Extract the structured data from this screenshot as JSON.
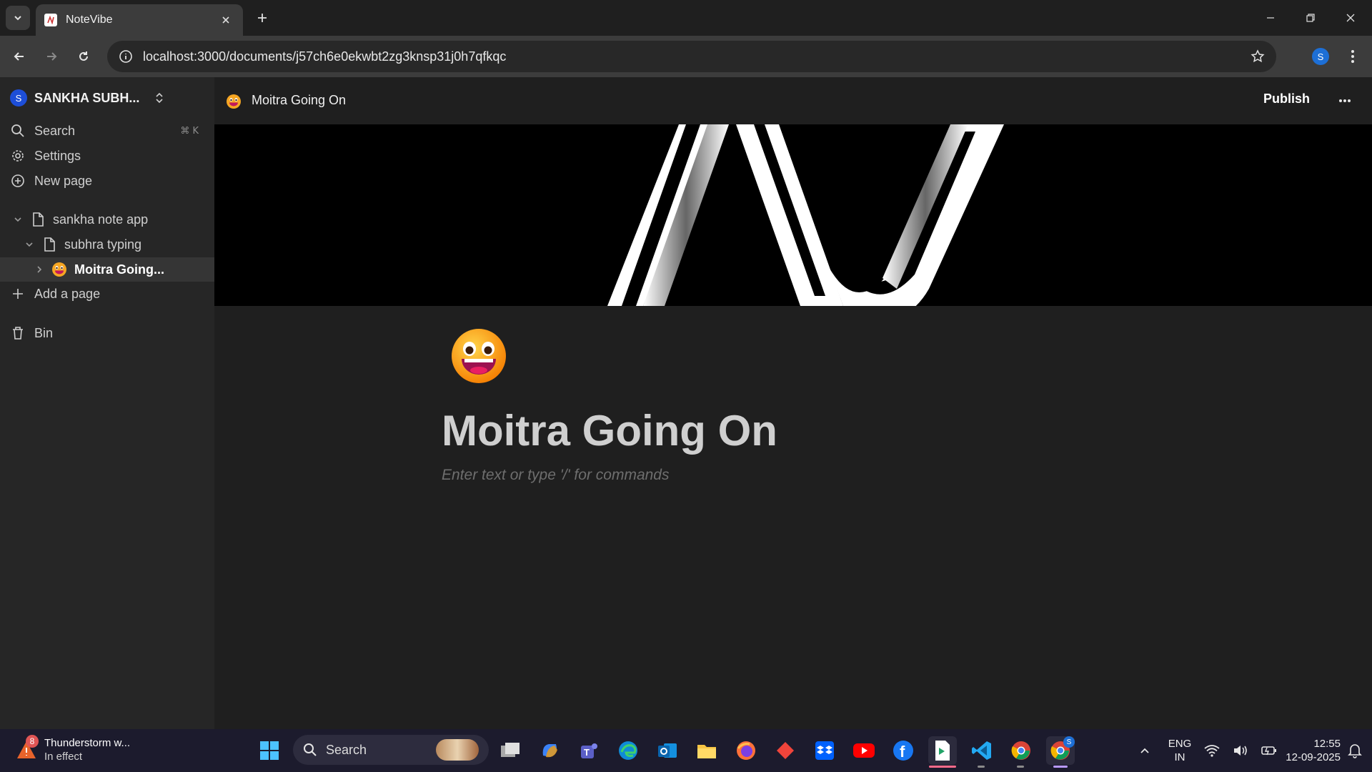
{
  "browser": {
    "tab_title": "NoteVibe",
    "url": "localhost:3000/documents/j57ch6e0ekwbt2zg3knsp31j0h7qfkqc",
    "profile_initial": "S"
  },
  "sidebar": {
    "workspace_initial": "S",
    "workspace_name": "SANKHA SUBH...",
    "search_label": "Search",
    "search_shortcut": "⌘ K",
    "settings_label": "Settings",
    "new_page_label": "New page",
    "pages": [
      {
        "label": "sankha note app"
      },
      {
        "label": "subhra typing"
      },
      {
        "label": "Moitra Going..."
      }
    ],
    "add_page_label": "Add a page",
    "bin_label": "Bin"
  },
  "document": {
    "breadcrumb_title": "Moitra Going On",
    "publish_label": "Publish",
    "title": "Moitra Going On",
    "placeholder": "Enter text or type '/' for commands",
    "icon": "grinning-face-emoji"
  },
  "taskbar": {
    "weather_badge": "8",
    "weather_title": "Thunderstorm w...",
    "weather_status": "In effect",
    "search_label": "Search",
    "lang_top": "ENG",
    "lang_bottom": "IN",
    "time": "12:55",
    "date": "12-09-2025",
    "chrome_profile_badge": "S",
    "apps": [
      "start-icon",
      "task-view-icon",
      "copilot-icon",
      "teams-icon",
      "edge-icon",
      "outlook-icon",
      "file-explorer-icon",
      "firefox-icon",
      "anydesk-icon",
      "dropbox-icon",
      "youtube-icon",
      "facebook-icon",
      "notevibe-icon",
      "vscode-icon",
      "chrome-icon",
      "chrome-profile-icon"
    ]
  },
  "colors": {
    "sidebar_bg": "#262626",
    "main_bg": "#1f1f1f",
    "active_row": "#353535",
    "taskbar_bg": "#1c1b2d"
  }
}
